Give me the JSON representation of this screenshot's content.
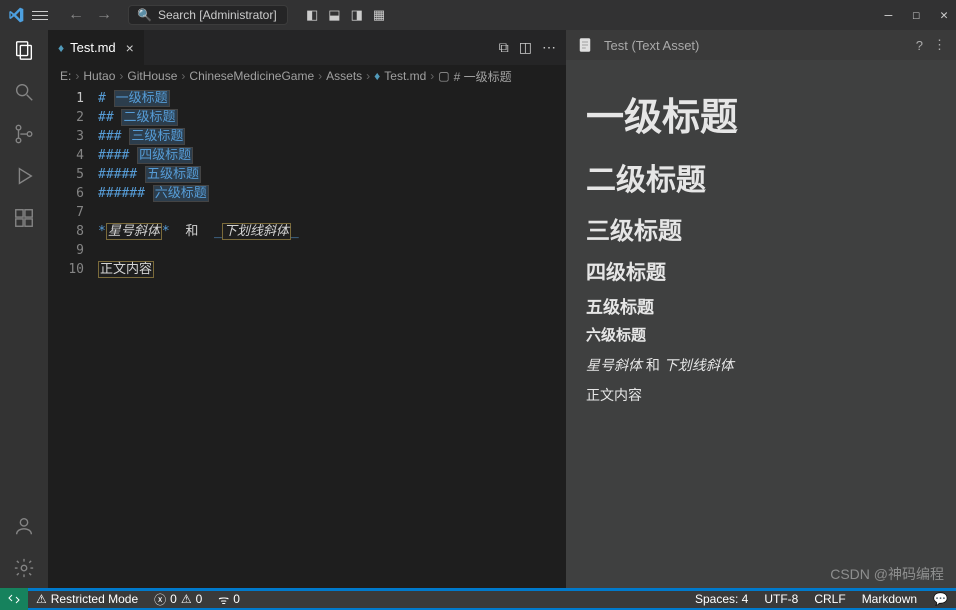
{
  "titlebar": {
    "search_label": "Search [Administrator]"
  },
  "tab": {
    "filename": "Test.md"
  },
  "breadcrumbs": {
    "items": [
      "E:",
      "Hutao",
      "GitHouse",
      "ChineseMedicineGame",
      "Assets",
      "Test.md",
      "# 一级标题"
    ]
  },
  "editor": {
    "lines": {
      "1": {
        "hash": "#",
        "text": "一级标题"
      },
      "2": {
        "hash": "##",
        "text": "二级标题"
      },
      "3": {
        "hash": "###",
        "text": "三级标题"
      },
      "4": {
        "hash": "####",
        "text": "四级标题"
      },
      "5": {
        "hash": "#####",
        "text": "五级标题"
      },
      "6": {
        "hash": "######",
        "text": "六级标题"
      },
      "8": {
        "star1": "*",
        "it1": "星号斜体",
        "star2": "*",
        "and": "  和  ",
        "us1": "_",
        "it2": "下划线斜体",
        "us2": "_"
      },
      "10": {
        "text": "正文内容"
      }
    },
    "line_numbers": [
      "1",
      "2",
      "3",
      "4",
      "5",
      "6",
      "7",
      "8",
      "9",
      "10"
    ]
  },
  "preview": {
    "title": "Test (Text Asset)",
    "h1": "一级标题",
    "h2": "二级标题",
    "h3": "三级标题",
    "h4": "四级标题",
    "h5": "五级标题",
    "h6": "六级标题",
    "italic1": "星号斜体",
    "and": " 和 ",
    "italic2": "下划线斜体",
    "body": "正文内容"
  },
  "statusbar": {
    "restricted": "Restricted Mode",
    "errors": "0",
    "warnings": "0",
    "ports": "0",
    "spaces": "Spaces: 4",
    "encoding": "UTF-8",
    "eol": "CRLF",
    "lang": "Markdown"
  },
  "watermark": "CSDN @神码编程"
}
